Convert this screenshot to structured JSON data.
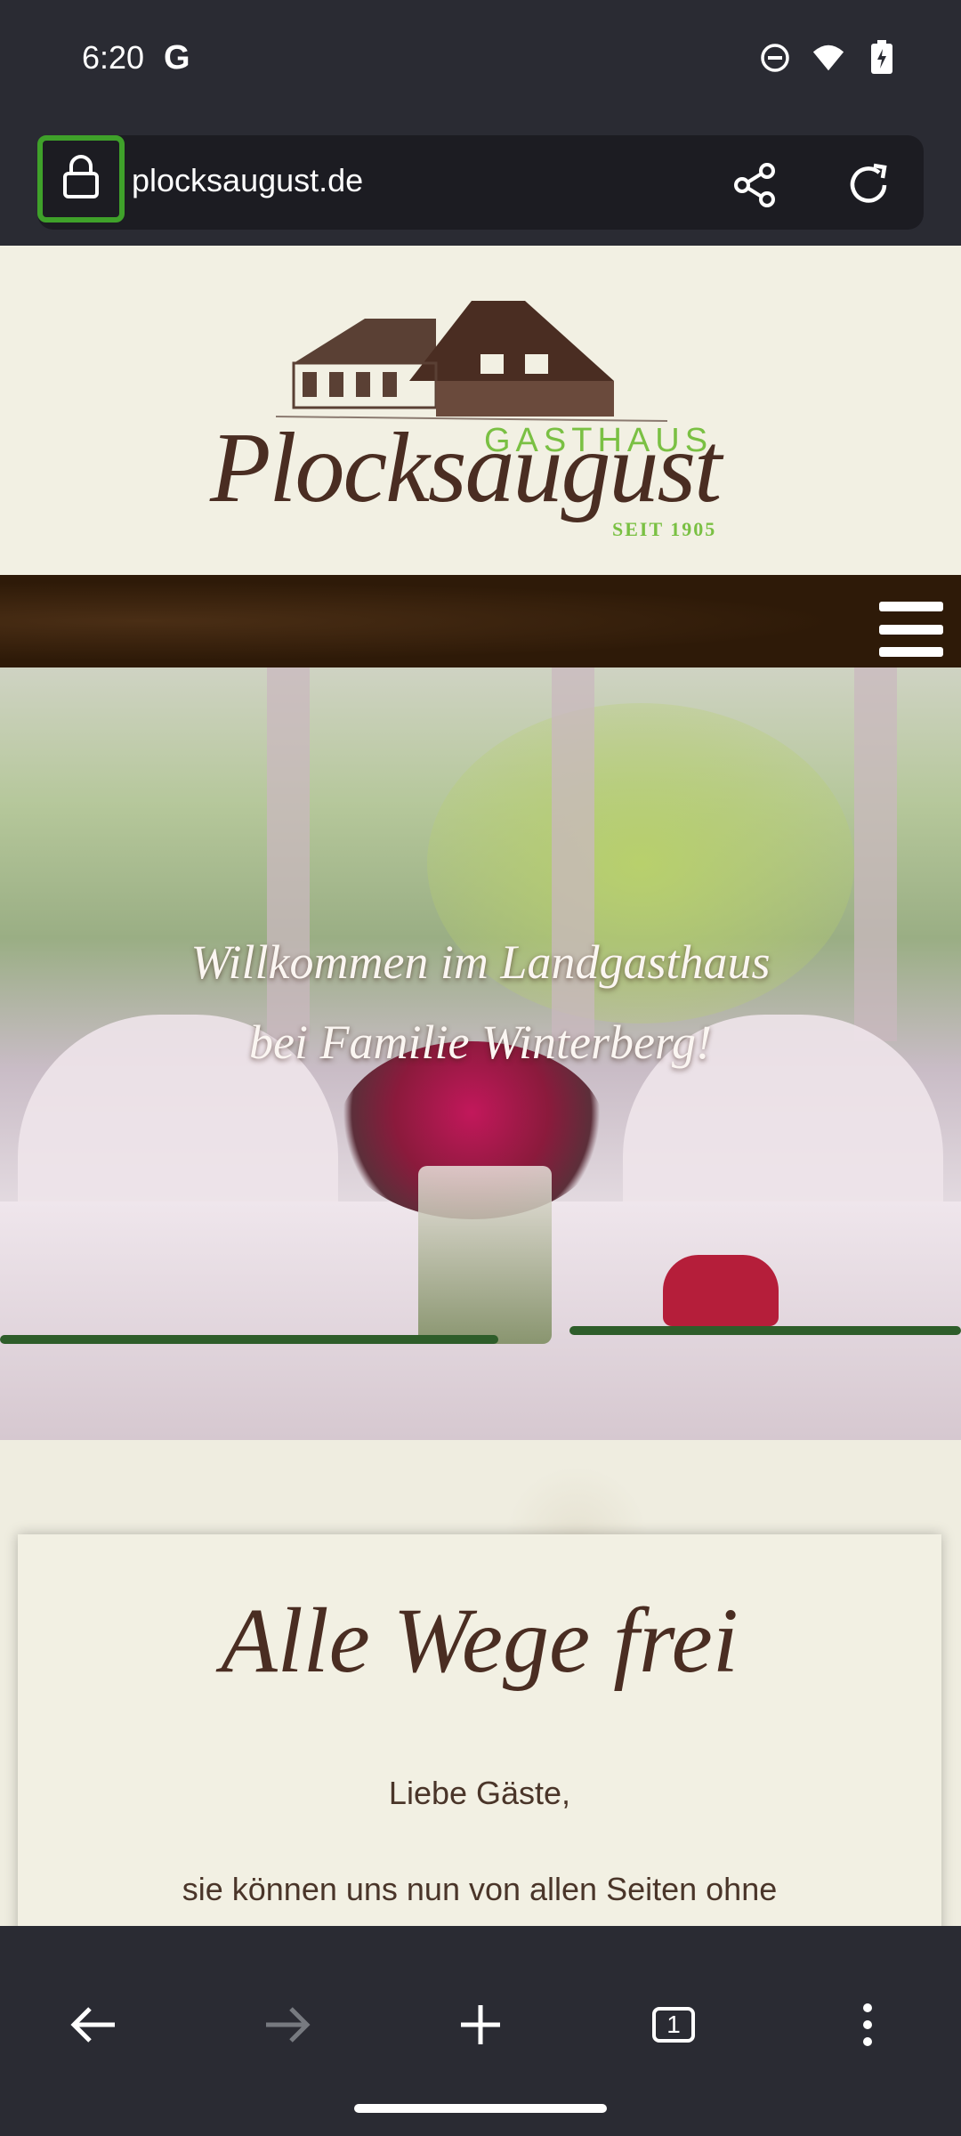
{
  "status_bar": {
    "time": "6:20",
    "google_badge": "G",
    "icons": [
      "do-not-disturb-icon",
      "wifi-icon",
      "battery-icon"
    ]
  },
  "browser": {
    "url": "plocksaugust.de",
    "icons": [
      "lock-icon",
      "share-icon",
      "reload-icon"
    ],
    "highlight_color": "#3fa12a"
  },
  "site": {
    "logo": {
      "gasthaus": "GASTHAUS",
      "name": "Plocksaugust",
      "seit": "SEIT 1905"
    },
    "nav": {
      "menu_icon": "hamburger-menu-icon",
      "bar_color": "#2e1a08"
    },
    "hero": {
      "line1": "Willkommen im Landgasthaus",
      "line2": "bei Familie Winterberg!"
    },
    "content": {
      "title": "Alle Wege frei",
      "greeting": "Liebe Gäste,",
      "body": "sie können uns nun von allen Seiten ohne Sperrung anfahren."
    },
    "colors": {
      "brown": "#4a2d22",
      "green": "#7ac043",
      "cream": "#f2f0e3"
    }
  },
  "bottom_bar": {
    "tab_count": "1",
    "icons": [
      "back-icon",
      "forward-icon",
      "new-tab-icon",
      "tabs-icon",
      "more-options-icon"
    ]
  }
}
